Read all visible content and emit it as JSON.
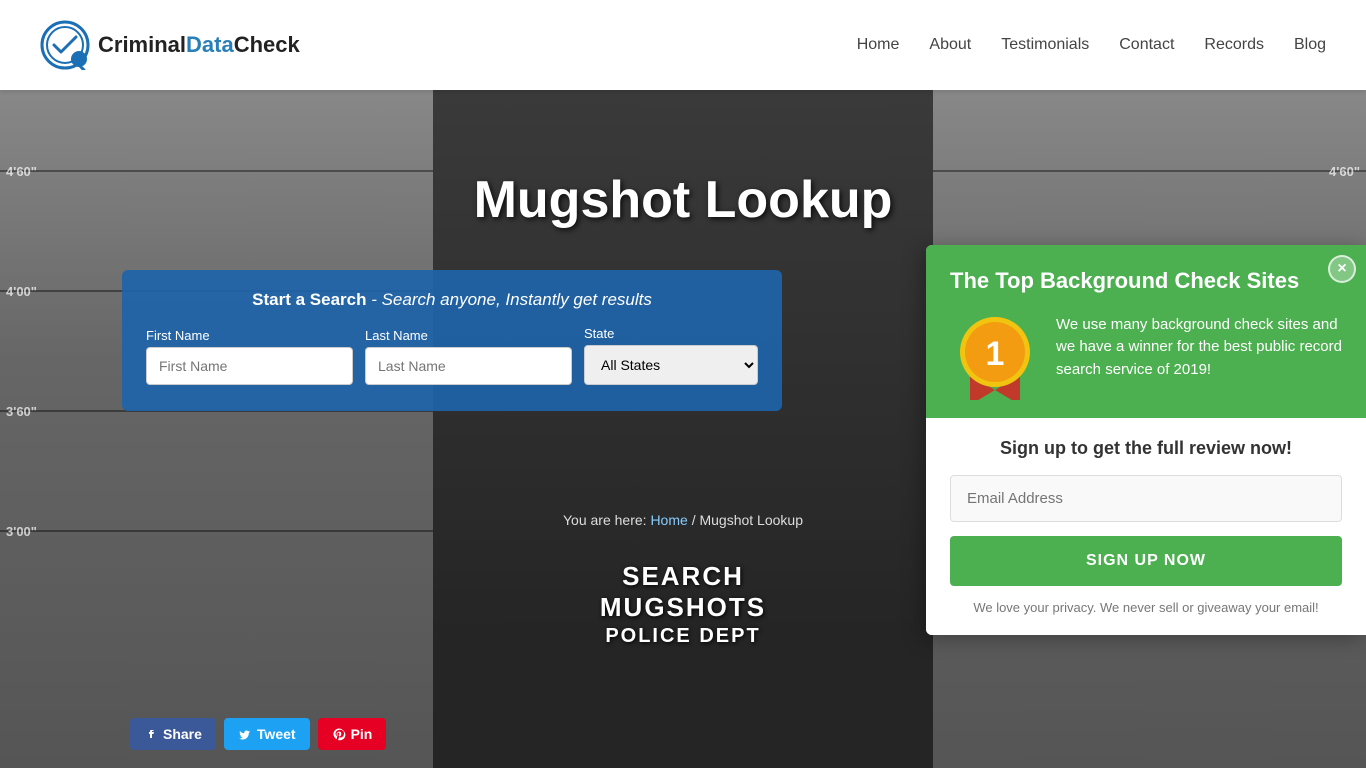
{
  "header": {
    "logo_text_criminal": "Criminal",
    "logo_text_data": "Data",
    "logo_text_check": "Check",
    "nav_items": [
      {
        "label": "Home",
        "href": "#"
      },
      {
        "label": "About",
        "href": "#"
      },
      {
        "label": "Testimonials",
        "href": "#"
      },
      {
        "label": "Contact",
        "href": "#"
      },
      {
        "label": "Records",
        "href": "#"
      },
      {
        "label": "Blog",
        "href": "#"
      }
    ]
  },
  "hero": {
    "title": "Mugshot Lookup",
    "ruler_labels": [
      "4'60\"",
      "4'00\"",
      "3'60\"",
      "3'00\""
    ],
    "search_box": {
      "subtitle_strong": "Start a Search",
      "subtitle_italic": " - Search anyone, Instantly get results",
      "first_name_label": "First Name",
      "first_name_placeholder": "First Name",
      "last_name_label": "Last Name",
      "last_name_placeholder": "Last Name",
      "state_label": "State",
      "state_default": "All States"
    },
    "breadcrumb": "You are here: Home / Mugshot Lookup",
    "breadcrumb_home": "Home",
    "breadcrumb_current": "Mugshot Lookup",
    "mugshot_line1": "SEARCH",
    "mugshot_line2": "MUGSHOTS",
    "mugshot_line3": "POLICE DEPT"
  },
  "social": {
    "facebook_label": "Share",
    "twitter_label": "Tweet",
    "pinterest_label": "Pin"
  },
  "popup": {
    "title": "The Top Background Check Sites",
    "close_icon": "×",
    "award_number": "1",
    "award_text": "We use many background check sites and we have a winner for the best public record search service of 2019!",
    "signup_title": "Sign up to get the full review now!",
    "email_placeholder": "Email Address",
    "signup_button": "SIGN UP NOW",
    "privacy_text": "We love your privacy.  We never sell or giveaway your email!"
  }
}
